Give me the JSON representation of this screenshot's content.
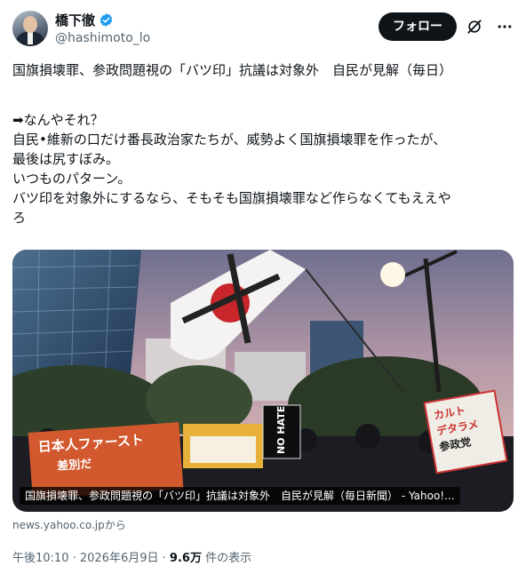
{
  "author": {
    "display_name": "橋下徹",
    "handle": "@hashimoto_lo"
  },
  "actions": {
    "follow_label": "フォロー"
  },
  "icons": {
    "verified": "verified-badge-icon",
    "grok": "grok-icon",
    "more": "more-options-icon"
  },
  "colors": {
    "verified_badge": "#1d9bf0",
    "follow_button": "#0f1419",
    "secondary_text": "#536471"
  },
  "tweet": {
    "line1": "国旗損壊罪、参政問題視の「バツ印」抗議は対象外　自民が見解（毎日）",
    "line2": "➡なんやそれ？",
    "line3": "自民•維新の口だけ番長政治家たちが、威勢よく国旗損壊罪を作ったが、",
    "line4": "最後は尻すぼみ。",
    "line5": "いつものパターン。",
    "line6": "バツ印を対象外にするなら、そもそも国旗損壊罪など作らなくてもええや",
    "line7": "ろ"
  },
  "card": {
    "caption": "国旗損壊罪、参政問題視の「バツ印」抗議は対象外　自民が見解（毎日新聞） - Yahoo!...",
    "domain": "news.yahoo.co.jpから",
    "photo_signs": {
      "left_banner": "日本人ファースト",
      "left_banner_sub": "差別だ",
      "black_sign": "NO HATE",
      "right_sign_1": "カルト",
      "right_sign_2": "デタラメ",
      "right_sign_3": "参政党"
    }
  },
  "meta": {
    "time": "午後10:10",
    "separator1": " · ",
    "date": "2026年6月9日",
    "separator2": " · ",
    "views_count": "9.6万",
    "views_label": " 件の表示"
  }
}
